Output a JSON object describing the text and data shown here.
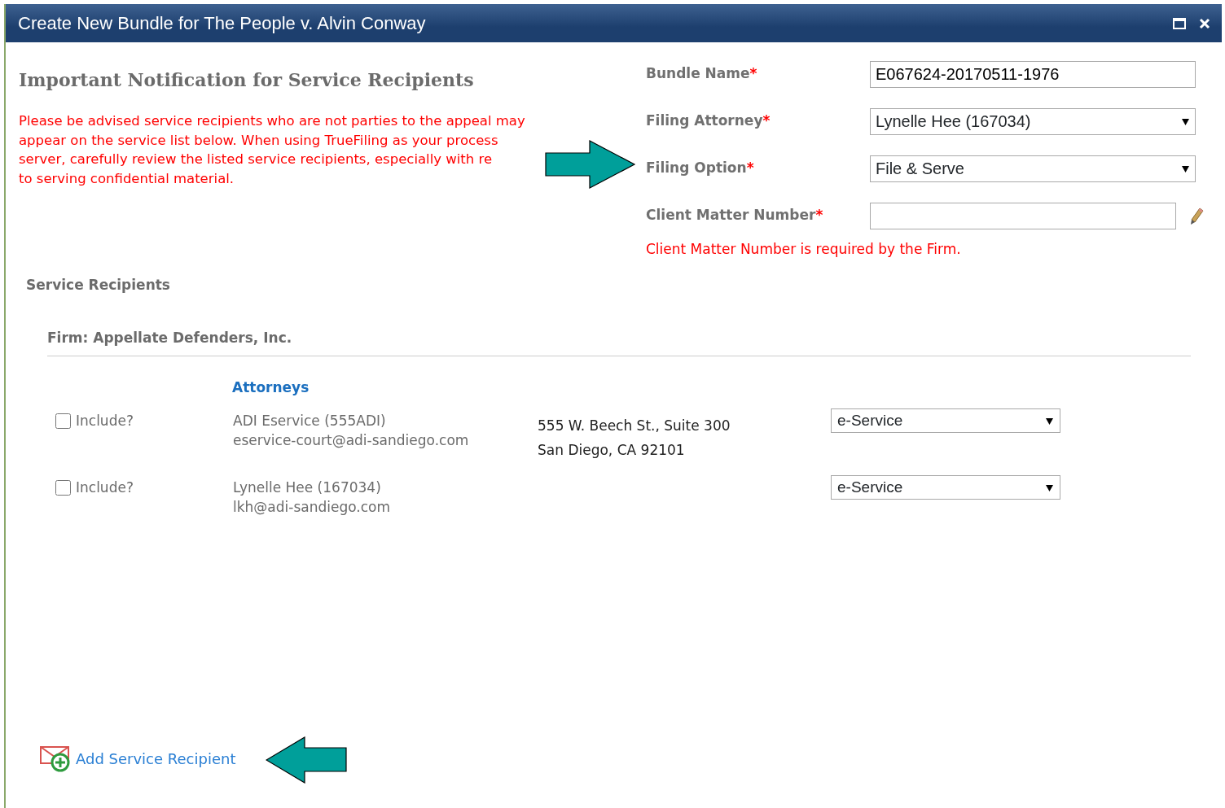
{
  "window": {
    "title": "Create New Bundle for The People v. Alvin Conway"
  },
  "notice": {
    "heading": "Important Notification for Service Recipients",
    "lines": [
      "Please be advised service recipients who are not parties to the appeal may",
      "appear on the service list below.  When using TrueFiling as your process",
      "server, carefully review the listed service recipients, especially with re",
      "to serving confidential material."
    ]
  },
  "form": {
    "fields": [
      {
        "kind": "text",
        "label": "Bundle Name",
        "required_mark": "*",
        "value": "E067624-20170511-1976"
      },
      {
        "kind": "select",
        "label": "Filing Attorney",
        "required_mark": "*",
        "value": "Lynelle Hee (167034)"
      },
      {
        "kind": "select",
        "label": "Filing Option",
        "required_mark": "*",
        "value": "File & Serve"
      },
      {
        "kind": "text-edit",
        "label": "Client Matter Number",
        "required_mark": "*"
      }
    ],
    "error": "Client Matter Number is required by the Firm."
  },
  "service_recipients": {
    "heading": "Service Recipients",
    "firm": "Firm: Appellate Defenders, Inc.",
    "group_heading": "Attorneys",
    "rows": [
      {
        "include_label": "Include?",
        "checked": false,
        "name": "ADI Eservice (555ADI)",
        "email": "eservice-court@adi-sandiego.com",
        "address_lines": [
          "555 W. Beech St., Suite 300",
          "San Diego, CA 92101"
        ],
        "method": "e-Service"
      },
      {
        "include_label": "Include?",
        "checked": false,
        "name": "Lynelle Hee (167034)",
        "email": "lkh@adi-sandiego.com",
        "method": "e-Service"
      }
    ]
  },
  "add_link": "Add Service Recipient"
}
